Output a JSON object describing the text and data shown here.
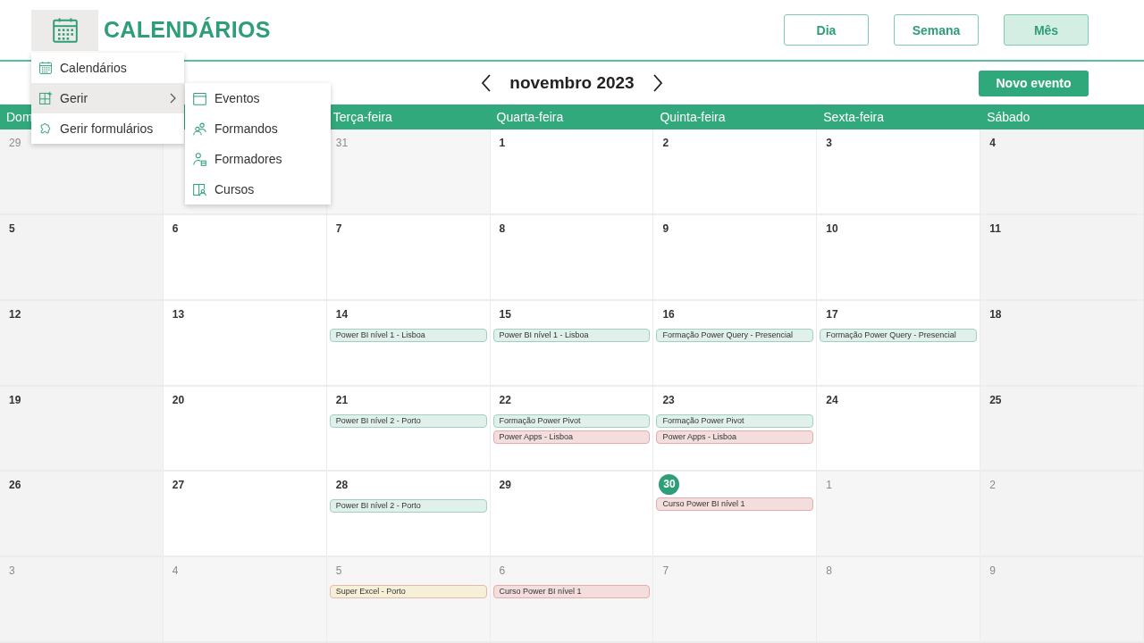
{
  "header": {
    "title": "CALENDÁRIOS",
    "views": [
      {
        "label": "Dia",
        "selected": false
      },
      {
        "label": "Semana",
        "selected": false
      },
      {
        "label": "Mês",
        "selected": true
      }
    ]
  },
  "nav": {
    "month": "novembro 2023",
    "new_event": "Novo evento"
  },
  "menu": {
    "items": [
      {
        "label": "Calendários",
        "kind": "calendar",
        "highlighted": false,
        "has_submenu": false
      },
      {
        "label": "Gerir",
        "kind": "grid",
        "highlighted": true,
        "has_submenu": true
      },
      {
        "label": "Gerir formulários",
        "kind": "puzzle",
        "highlighted": false,
        "has_submenu": false
      }
    ]
  },
  "submenu": {
    "items": [
      {
        "label": "Eventos",
        "kind": "calendar-blank"
      },
      {
        "label": "Formandos",
        "kind": "people"
      },
      {
        "label": "Formadores",
        "kind": "person-card"
      },
      {
        "label": "Cursos",
        "kind": "book"
      }
    ]
  },
  "weekdays": {
    "before_menu": [
      {
        "label": "Dom"
      }
    ],
    "after_menu": [
      {
        "label": "Terça-feira"
      },
      {
        "label": "Quarta-feira"
      },
      {
        "label": "Quinta-feira"
      },
      {
        "label": "Sexta-feira"
      },
      {
        "label": "Sábado"
      }
    ]
  },
  "weeks": [
    {
      "before_menu": [
        {
          "day": "29",
          "other_month": true
        }
      ],
      "after_menu": [
        {
          "day": "31",
          "other_month": true
        },
        {
          "day": "1",
          "other_month": false
        },
        {
          "day": "2",
          "other_month": false
        },
        {
          "day": "3",
          "other_month": false
        },
        {
          "day": "4",
          "other_month": false
        }
      ]
    },
    {
      "days": [
        {
          "day": "5",
          "other_month": false
        },
        {
          "day": "6",
          "other_month": false
        },
        {
          "day": "7",
          "other_month": false
        },
        {
          "day": "8",
          "other_month": false
        },
        {
          "day": "9",
          "other_month": false
        },
        {
          "day": "10",
          "other_month": false
        },
        {
          "day": "11",
          "other_month": false
        }
      ]
    },
    {
      "days": [
        {
          "day": "12",
          "other_month": false
        },
        {
          "day": "13",
          "other_month": false
        },
        {
          "day": "14",
          "other_month": false,
          "events": [
            {
              "title": "Power BI nível 1 - Lisboa",
              "color": "#dff1ea"
            }
          ]
        },
        {
          "day": "15",
          "other_month": false,
          "events": [
            {
              "title": "Power BI nível 1 - Lisboa",
              "color": "#dff1ea"
            }
          ]
        },
        {
          "day": "16",
          "other_month": false,
          "events": [
            {
              "title": "Formação Power Query - Presencial",
              "color": "#dff1ea"
            }
          ]
        },
        {
          "day": "17",
          "other_month": false,
          "events": [
            {
              "title": "Formação Power Query - Presencial",
              "color": "#dff1ea"
            }
          ]
        },
        {
          "day": "18",
          "other_month": false
        }
      ]
    },
    {
      "days": [
        {
          "day": "19",
          "other_month": false
        },
        {
          "day": "20",
          "other_month": false
        },
        {
          "day": "21",
          "other_month": false,
          "events": [
            {
              "title": "Power BI nível 2 - Porto",
              "color": "#dff1ea"
            }
          ]
        },
        {
          "day": "22",
          "other_month": false,
          "events": [
            {
              "title": "Formação Power Pivot",
              "color": "#dff1ea"
            },
            {
              "title": "Power Apps - Lisboa",
              "color": "#f3dddd"
            }
          ]
        },
        {
          "day": "23",
          "other_month": false,
          "events": [
            {
              "title": "Formação Power Pivot",
              "color": "#dff1ea"
            },
            {
              "title": "Power Apps - Lisboa",
              "color": "#f3dddd"
            }
          ]
        },
        {
          "day": "24",
          "other_month": false
        },
        {
          "day": "25",
          "other_month": false
        }
      ]
    },
    {
      "days": [
        {
          "day": "26",
          "other_month": false
        },
        {
          "day": "27",
          "other_month": false
        },
        {
          "day": "28",
          "other_month": false,
          "events": [
            {
              "title": "Power BI nível 2 - Porto",
              "color": "#dff1ea"
            }
          ]
        },
        {
          "day": "29",
          "other_month": false
        },
        {
          "day": "30",
          "other_month": false,
          "today": true,
          "events": [
            {
              "title": "Curso Power BI nível 1",
              "color": "#f3dddd"
            }
          ]
        },
        {
          "day": "1",
          "other_month": true
        },
        {
          "day": "2",
          "other_month": true
        }
      ]
    },
    {
      "days": [
        {
          "day": "3",
          "other_month": true
        },
        {
          "day": "4",
          "other_month": true
        },
        {
          "day": "5",
          "other_month": true,
          "events": [
            {
              "title": "Super Excel - Porto",
              "color": "#f7f0d8"
            }
          ]
        },
        {
          "day": "6",
          "other_month": true,
          "events": [
            {
              "title": "Curso Power BI nível 1",
              "color": "#f3dddd"
            }
          ]
        },
        {
          "day": "7",
          "other_month": true
        },
        {
          "day": "8",
          "other_month": true
        },
        {
          "day": "9",
          "other_month": true
        }
      ]
    }
  ]
}
